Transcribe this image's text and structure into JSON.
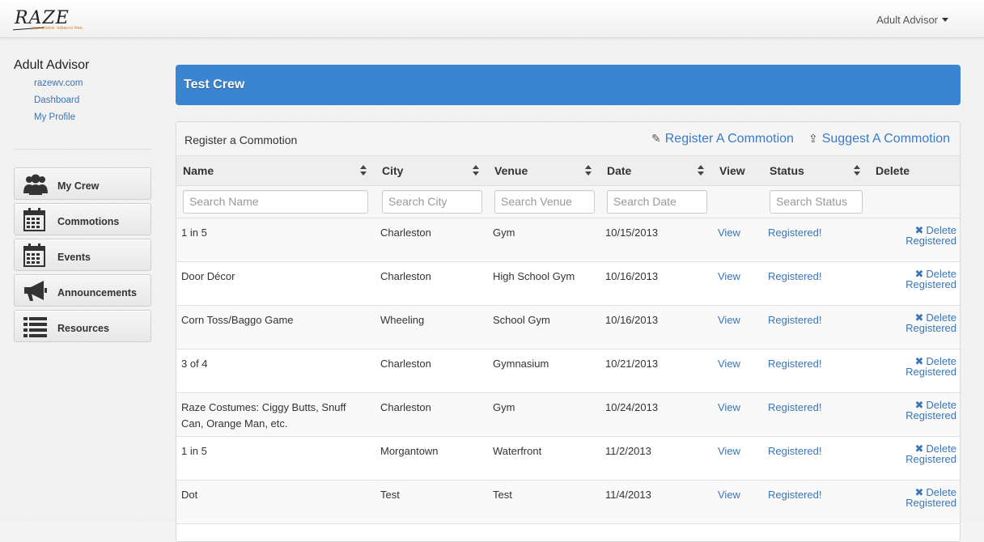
{
  "header": {
    "logo_text": "RAZE",
    "logo_tagline": "your choice. tobacco free.",
    "user_menu": "Adult Advisor"
  },
  "sidebar": {
    "title": "Adult Advisor",
    "links": [
      "razewv.com",
      "Dashboard",
      "My Profile"
    ],
    "nav": [
      {
        "label": "My Crew",
        "icon": "group-icon"
      },
      {
        "label": "Commotions",
        "icon": "calendar-icon"
      },
      {
        "label": "Events",
        "icon": "calendar-icon"
      },
      {
        "label": "Announcements",
        "icon": "megaphone-icon"
      },
      {
        "label": "Resources",
        "icon": "list-icon"
      }
    ]
  },
  "banner": {
    "title": "Test Crew"
  },
  "panel": {
    "title": "Register a Commotion",
    "register_action": "Register A Commotion",
    "suggest_action": "Suggest A Commotion"
  },
  "table": {
    "columns": [
      "Name",
      "City",
      "Venue",
      "Date",
      "View",
      "Status",
      "Delete"
    ],
    "placeholders": {
      "name": "Search Name",
      "city": "Search City",
      "venue": "Search Venue",
      "date": "Search Date",
      "status": "Search Status"
    },
    "rows": [
      {
        "name": "1 in 5",
        "city": "Charleston",
        "venue": "Gym",
        "date": "10/15/2013",
        "view": "View",
        "status": "Registered!",
        "delete1": "Delete",
        "delete2": "Registered"
      },
      {
        "name": "Door Décor",
        "city": "Charleston",
        "venue": "High School Gym",
        "date": "10/16/2013",
        "view": "View",
        "status": "Registered!",
        "delete1": "Delete",
        "delete2": "Registered"
      },
      {
        "name": "Corn Toss/Baggo Game",
        "city": "Wheeling",
        "venue": "School Gym",
        "date": "10/16/2013",
        "view": "View",
        "status": "Registered!",
        "delete1": "Delete",
        "delete2": "Registered"
      },
      {
        "name": "3 of 4",
        "city": "Charleston",
        "venue": "Gymnasium",
        "date": "10/21/2013",
        "view": "View",
        "status": "Registered!",
        "delete1": "Delete",
        "delete2": "Registered"
      },
      {
        "name": "Raze Costumes: Ciggy Butts, Snuff Can, Orange Man, etc.",
        "city": "Charleston",
        "venue": "Gym",
        "date": "10/24/2013",
        "view": "View",
        "status": "Registered!",
        "delete1": "Delete",
        "delete2": "Registered"
      },
      {
        "name": "1 in 5",
        "city": "Morgantown",
        "venue": "Waterfront",
        "date": "11/2/2013",
        "view": "View",
        "status": "Registered!",
        "delete1": "Delete",
        "delete2": "Registered"
      },
      {
        "name": "Dot",
        "city": "Test",
        "venue": "Test",
        "date": "11/4/2013",
        "view": "View",
        "status": "Registered!",
        "delete1": "Delete",
        "delete2": "Registered"
      }
    ]
  },
  "colors": {
    "banner": "#3b84d0",
    "link": "#3a75b8",
    "logo_tagline": "#e07a20"
  }
}
